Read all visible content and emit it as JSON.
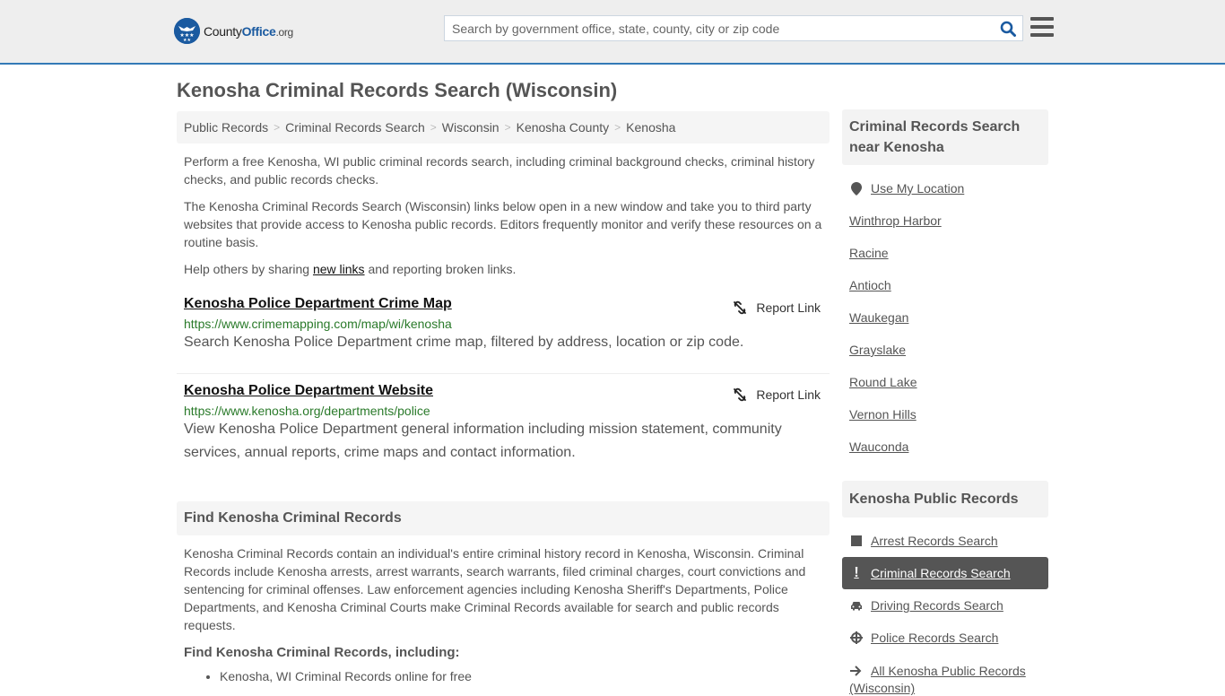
{
  "header": {
    "logo_county": "County",
    "logo_office": "Office",
    "logo_org": ".org",
    "search_placeholder": "Search by government office, state, county, city or zip code",
    "search_value": ""
  },
  "page": {
    "title": "Kenosha Criminal Records Search (Wisconsin)"
  },
  "breadcrumb": [
    {
      "label": "Public Records"
    },
    {
      "label": "Criminal Records Search"
    },
    {
      "label": "Wisconsin"
    },
    {
      "label": "Kenosha County"
    },
    {
      "label": "Kenosha"
    }
  ],
  "intro": {
    "p1": "Perform a free Kenosha, WI public criminal records search, including criminal background checks, criminal history checks, and public records checks.",
    "p2": "The Kenosha Criminal Records Search (Wisconsin) links below open in a new window and take you to third party websites that provide access to Kenosha public records. Editors frequently monitor and verify these resources on a routine basis.",
    "p3_before": "Help others by sharing ",
    "p3_link": "new links",
    "p3_after": " and reporting broken links."
  },
  "links": [
    {
      "title": "Kenosha Police Department Crime Map",
      "url": "https://www.crimemapping.com/map/wi/kenosha",
      "description": "Search Kenosha Police Department crime map, filtered by address, location or zip code.",
      "report_label": "Report Link"
    },
    {
      "title": "Kenosha Police Department Website",
      "url": "https://www.kenosha.org/departments/police",
      "description": "View Kenosha Police Department general information including mission statement, community services, annual reports, crime maps and contact information.",
      "report_label": "Report Link"
    }
  ],
  "find_section": {
    "heading": "Find Kenosha Criminal Records",
    "body": "Kenosha Criminal Records contain an individual's entire criminal history record in Kenosha, Wisconsin. Criminal Records include Kenosha arrests, arrest warrants, search warrants, filed criminal charges, court convictions and sentencing for criminal offenses. Law enforcement agencies including Kenosha Sheriff's Departments, Police Departments, and Kenosha Criminal Courts make Criminal Records available for search and public records requests.",
    "subheading": "Find Kenosha Criminal Records, including:",
    "bullets": [
      "Kenosha, WI Criminal Records online for free"
    ]
  },
  "sidebar": {
    "nearby_heading": "Criminal Records Search near Kenosha",
    "use_location": "Use My Location",
    "nearby": [
      "Winthrop Harbor",
      "Racine",
      "Antioch",
      "Waukegan",
      "Grayslake",
      "Round Lake",
      "Vernon Hills",
      "Wauconda"
    ],
    "public_heading": "Kenosha Public Records",
    "public_links": [
      {
        "label": "Arrest Records Search",
        "icon": "square-icon",
        "active": false
      },
      {
        "label": "Criminal Records Search",
        "icon": "exclamation-icon",
        "active": true
      },
      {
        "label": "Driving Records Search",
        "icon": "car-icon",
        "active": false
      },
      {
        "label": "Police Records Search",
        "icon": "crosshair-icon",
        "active": false
      },
      {
        "label": "All Kenosha Public Records (Wisconsin)",
        "icon": "arrow-right-icon",
        "active": false
      }
    ]
  },
  "colors": {
    "brand_blue": "#1a5aa0",
    "accent_border": "#337ab7",
    "url_green": "#2a7a2a",
    "active_bg": "#555555"
  }
}
